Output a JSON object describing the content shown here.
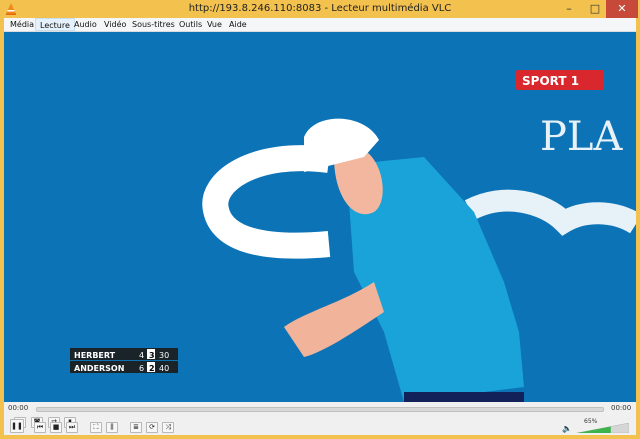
{
  "window": {
    "title": "http://193.8.246.110:8083 - Lecteur multimédia VLC"
  },
  "menu": [
    {
      "label": "Média"
    },
    {
      "label": "Lecture"
    },
    {
      "label": "Audio"
    },
    {
      "label": "Vidéo"
    },
    {
      "label": "Sous-titres"
    },
    {
      "label": "Outils"
    },
    {
      "label": "Vue"
    },
    {
      "label": "Aide"
    }
  ],
  "video": {
    "channel_logo": "SPORT 1",
    "scoreboard": [
      {
        "player": "HERBERT",
        "sets": "4",
        "games": "3",
        "points": "30"
      },
      {
        "player": "ANDERSON",
        "sets": "6",
        "games": "2",
        "points": "40"
      }
    ],
    "banner_text": "PLA"
  },
  "playback": {
    "elapsed": "00:00",
    "remaining": "00:00"
  },
  "volume": {
    "label": "65%",
    "level": 0.65
  },
  "colors": {
    "titlebar": "#f2c14e",
    "video_bg": "#0c73b6",
    "close": "#c7493a",
    "volume": "#3cb44b"
  },
  "icons": [
    "vlc-cone-icon",
    "record-icon",
    "snapshot-icon",
    "loop-ab-icon",
    "frame-step-icon",
    "pause-icon",
    "previous-icon",
    "stop-icon",
    "next-icon",
    "fullscreen-icon",
    "extended-settings-icon",
    "playlist-icon",
    "loop-icon",
    "shuffle-icon",
    "speaker-icon"
  ]
}
